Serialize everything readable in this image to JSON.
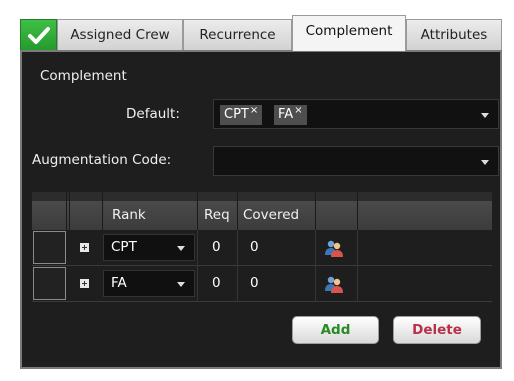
{
  "tabs": [
    {
      "label": "Assigned Crew"
    },
    {
      "label": "Recurrence"
    },
    {
      "label": "Complement",
      "active": true
    },
    {
      "label": "Attributes"
    }
  ],
  "status_color": "#2fae37",
  "complement": {
    "section_title": "Complement",
    "default_label": "Default:",
    "default_chips": [
      {
        "label": "CPT",
        "remove": "×"
      },
      {
        "label": "FA",
        "remove": "×"
      }
    ],
    "augmentation_label": "Augmentation Code:",
    "augmentation_value": ""
  },
  "grid": {
    "columns": [
      "",
      "",
      "Rank",
      "Req",
      "Covered",
      "",
      ""
    ],
    "rows": [
      {
        "rank": "CPT",
        "req": "0",
        "covered": "0",
        "icon": "crew-members-icon"
      },
      {
        "rank": "FA",
        "req": "0",
        "covered": "0",
        "icon": "crew-members-icon"
      }
    ]
  },
  "buttons": {
    "add": "Add",
    "delete": "Delete"
  }
}
